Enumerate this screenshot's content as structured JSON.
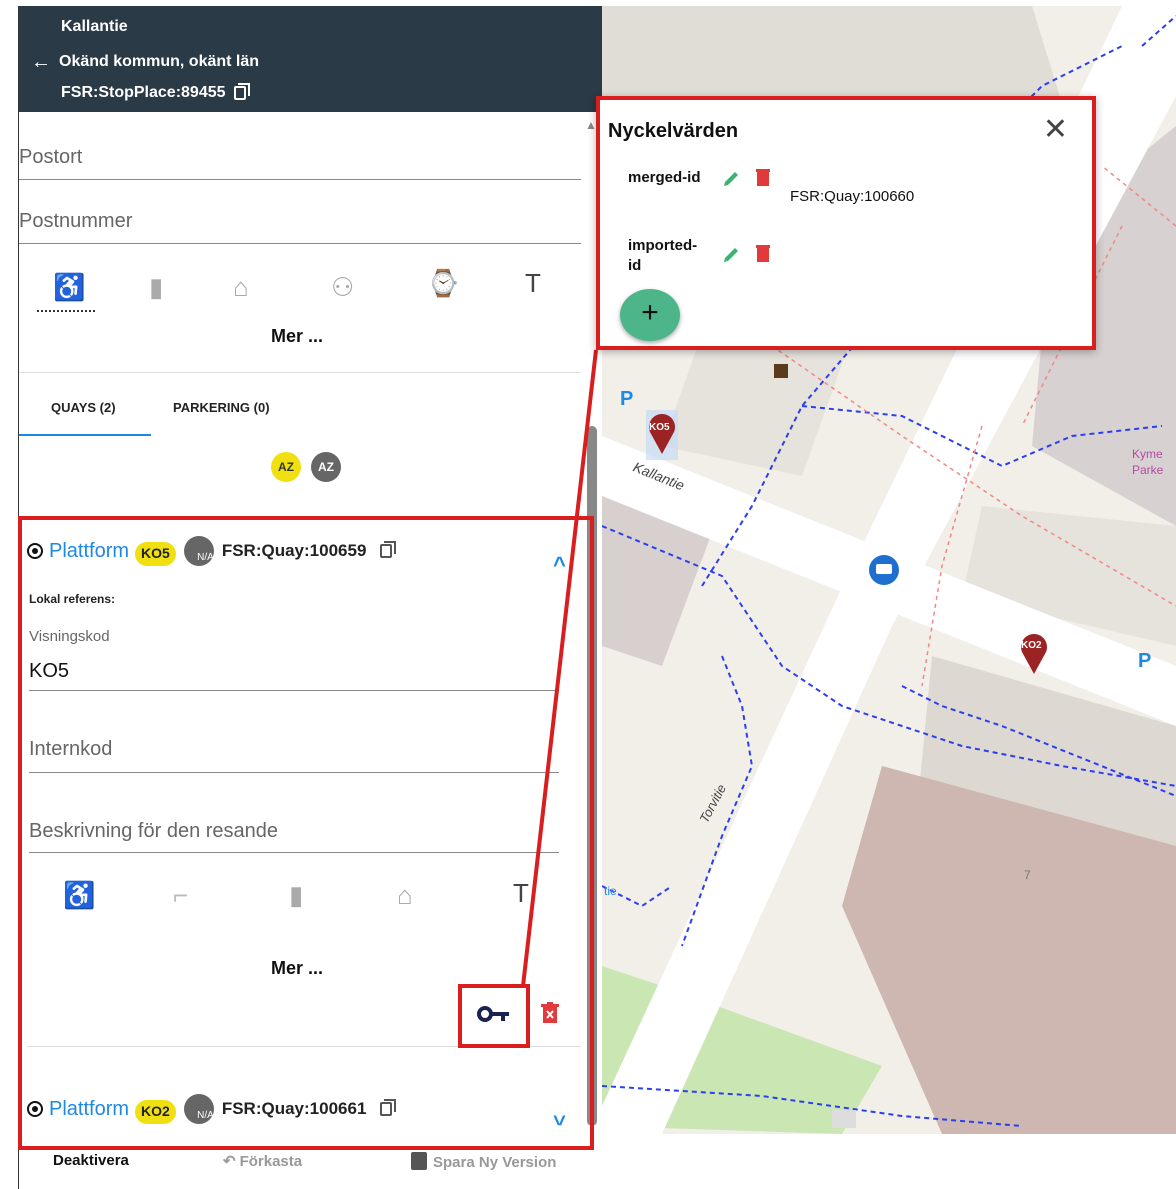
{
  "header": {
    "stop_name": "Kallantie",
    "location": "Okänd kommun, okänt län",
    "stop_place_id": "FSR:StopPlace:89455"
  },
  "fields": {
    "postort_placeholder": "Postort",
    "postnummer_placeholder": "Postnummer"
  },
  "more_label": "Mer ...",
  "tabs": {
    "quays": "QUAYS (2)",
    "parking": "PARKERING (0)"
  },
  "sort": {
    "az_label": "AZ",
    "az_alt_label": "AZ"
  },
  "quay1": {
    "type": "Plattform",
    "code": "KO5",
    "na": "N/A",
    "id": "FSR:Quay:100659",
    "local_ref_label": "Lokal referens:",
    "display_code_label": "Visningskod",
    "display_code_value": "KO5",
    "internal_code_placeholder": "Internkod",
    "description_placeholder": "Beskrivning för den resande",
    "more_label": "Mer ..."
  },
  "quay2": {
    "type": "Plattform",
    "code": "KO2",
    "na": "N/A",
    "id": "FSR:Quay:100661"
  },
  "actions": {
    "deactivate": "Deaktivera",
    "discard": "Förkasta",
    "save": "Spara Ny Version"
  },
  "popup": {
    "title": "Nyckelvärden",
    "entries": [
      {
        "key": "merged-id",
        "value": "FSR:Quay:100660"
      },
      {
        "key_line1": "imported-",
        "key_line2": "id",
        "value": ""
      }
    ]
  },
  "map": {
    "street1": "Kallantie",
    "street2": "Torvitie",
    "marker1": "KO5",
    "marker2": "KO2",
    "parking_label": "P",
    "number_label": "7",
    "poi_label": "Kyme Parke",
    "partial_label": "tie"
  },
  "colors": {
    "header_bg": "#2a3a46",
    "accent_blue": "#1e88e5",
    "badge_yellow": "#f0e012",
    "highlight_red": "#d81e1e",
    "fab_green": "#4cb68a",
    "marker_red": "#9b2323"
  }
}
